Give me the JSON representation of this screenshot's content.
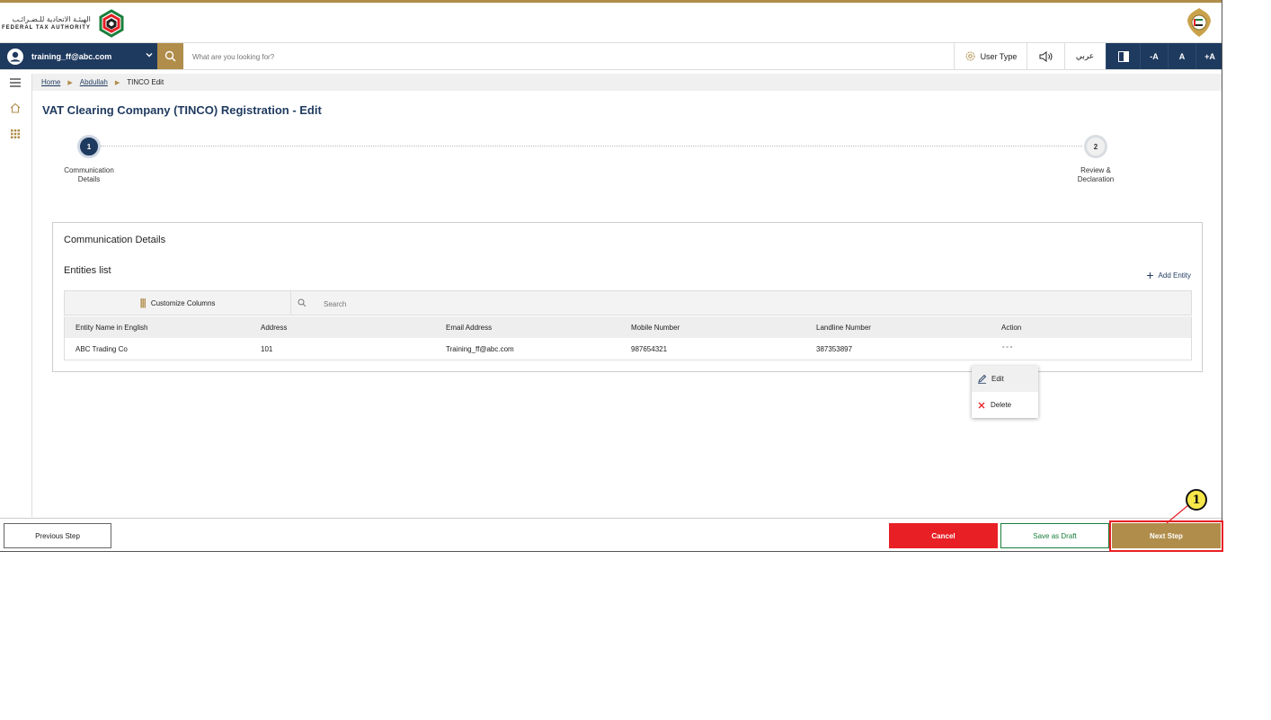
{
  "header": {
    "logo_arabic": "الهيئـة الاتحادية للـضـرائـب",
    "logo_english": "FEDERAL TAX AUTHORITY"
  },
  "topbar": {
    "user_email": "training_ff@abc.com",
    "search_placeholder": "What are you looking for?",
    "user_type_label": "User Type",
    "language_label": "عربي",
    "font_decrease": "-A",
    "font_normal": "A",
    "font_increase": "+A"
  },
  "breadcrumb": {
    "home": "Home",
    "level1": "Abdullah",
    "current": "TINCO Edit"
  },
  "page": {
    "title": "VAT Clearing Company (TINCO) Registration - Edit"
  },
  "stepper": {
    "steps": [
      {
        "number": "1",
        "label_line1": "Communication",
        "label_line2": "Details",
        "active": true
      },
      {
        "number": "2",
        "label_line1": "Review &",
        "label_line2": "Declaration",
        "active": false
      }
    ]
  },
  "card": {
    "title": "Communication Details",
    "subtitle": "Entities list",
    "add_entity_label": "Add Entity",
    "customize_columns_label": "Customize Columns",
    "search_placeholder": "Search",
    "columns": [
      "Entity Name in English",
      "Address",
      "Email Address",
      "Mobile Number",
      "Landline Number",
      "Action"
    ],
    "rows": [
      {
        "entity_name": "ABC Trading Co",
        "address": "101",
        "email": "Training_ff@abc.com",
        "mobile": "987654321",
        "landline": "387353897",
        "action": "∘∘∘"
      }
    ]
  },
  "action_menu": {
    "edit_label": "Edit",
    "delete_label": "Delete"
  },
  "footer": {
    "previous_label": "Previous Step",
    "cancel_label": "Cancel",
    "draft_label": "Save as Draft",
    "next_label": "Next Step"
  },
  "annotation": {
    "marker_number": "1"
  },
  "colors": {
    "brand_navy": "#1f3a5f",
    "brand_gold": "#b08d4a",
    "danger_red": "#e81f25",
    "draft_green": "#1a7f3c"
  }
}
